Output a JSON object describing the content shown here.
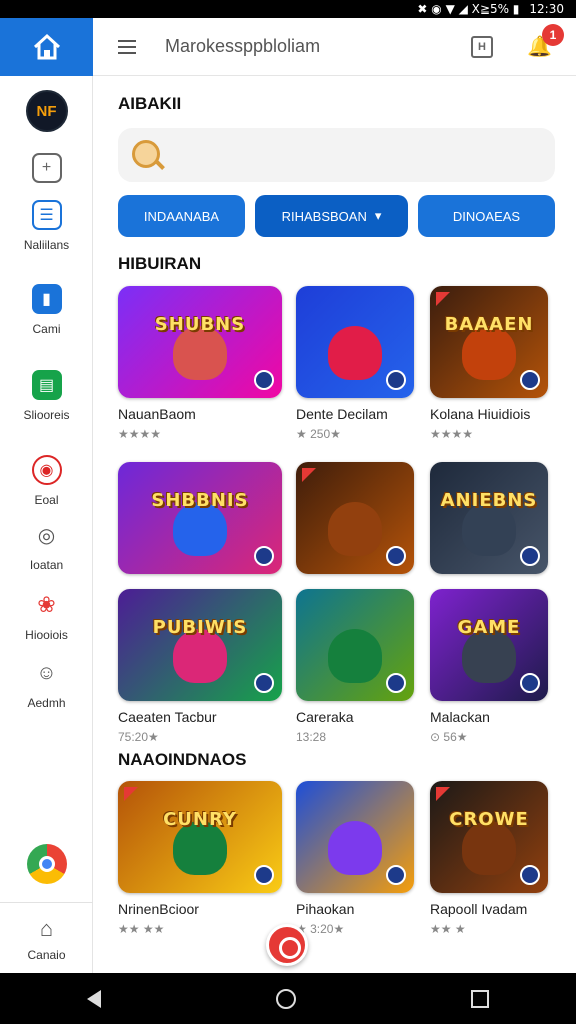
{
  "status_bar": {
    "battery": "✖ ◉ ▼ ◢ X≧5% ▮",
    "time": "12:30"
  },
  "topbar": {
    "title": "Marokessppbloliam",
    "notification_count": "1"
  },
  "sidebar": {
    "logo_text": "NF",
    "items": [
      {
        "label": "",
        "icon": "grid-add-icon",
        "color": "#666"
      },
      {
        "label": "Naliilans",
        "icon": "browser-window-icon",
        "color": "#1a73d9"
      },
      {
        "label": "Cami",
        "icon": "door-icon",
        "color": "#1a73d9"
      },
      {
        "label": "Sliooreis",
        "icon": "cup-icon",
        "color": "#16a34a"
      },
      {
        "label": "Eoal",
        "icon": "target-icon",
        "color": "#dc2626"
      },
      {
        "label": "Ioatan",
        "icon": "ring-icon",
        "color": "#555"
      },
      {
        "label": "Hiooiois",
        "icon": "pinwheel-icon",
        "color": "#e53935"
      },
      {
        "label": "Aedmh",
        "icon": "smiley-icon",
        "color": "#555"
      }
    ],
    "bottom_label": "Canaio"
  },
  "main": {
    "heading": "AIBAKII",
    "chips": [
      {
        "label": "INDAANABA",
        "color": "#1a73d9"
      },
      {
        "label": "RIHABSBOAN",
        "color": "#0b5fc4"
      },
      {
        "label": "DINOAEAS",
        "color": "#1a73d9"
      }
    ],
    "section1_title": "HIBUIRAN",
    "section2_title": "NAAOINDNAOS",
    "games": [
      {
        "name": "NauanBaom",
        "meta": "★★★★",
        "thumb_text": "SHUBNS",
        "bg": "linear-gradient(135deg,#7b2ff7,#f107a3)",
        "char": "#d9534f",
        "hot": false
      },
      {
        "name": "Dente Decilam",
        "meta": "★ 250★",
        "thumb_text": "",
        "bg": "linear-gradient(135deg,#1e3ed8,#2563eb)",
        "char": "#e11d48",
        "hot": false
      },
      {
        "name": "Kolana Hiuidiois",
        "meta": "★★★★",
        "thumb_text": "BAAAEN",
        "bg": "linear-gradient(135deg,#3b1d0e,#b45309)",
        "char": "#c2410c",
        "hot": true
      },
      {
        "name": "",
        "meta": "",
        "thumb_text": "SHBBNIS",
        "bg": "linear-gradient(135deg,#6d28d9,#db2777)",
        "char": "#2563eb",
        "hot": false
      },
      {
        "name": "",
        "meta": "",
        "thumb_text": "",
        "bg": "linear-gradient(135deg,#3f1d0b,#b45309)",
        "char": "#92400e",
        "hot": true
      },
      {
        "name": "",
        "meta": "",
        "thumb_text": "ANIEBNS",
        "bg": "linear-gradient(135deg,#1e293b,#475569)",
        "char": "#334155",
        "hot": false
      },
      {
        "name": "Caeaten Tacbur",
        "meta": "75:20★",
        "thumb_text": "PUBIWIS",
        "bg": "linear-gradient(135deg,#4c1d95,#16a34a)",
        "char": "#db2777",
        "hot": false
      },
      {
        "name": "Careraka",
        "meta": "13:28",
        "thumb_text": "",
        "bg": "linear-gradient(135deg,#0e7490,#65a30d)",
        "char": "#15803d",
        "hot": false
      },
      {
        "name": "Malackan",
        "meta": "⊙ 56★",
        "thumb_text": "GAME",
        "bg": "linear-gradient(135deg,#7e22ce,#1e1b4b)",
        "char": "#374151",
        "hot": false
      },
      {
        "name": "NrinenBcioor",
        "meta": "★★ ★★",
        "thumb_text": "CUNRY",
        "bg": "linear-gradient(135deg,#b45309,#facc15)",
        "char": "#15803d",
        "hot": true
      },
      {
        "name": "Pihaokan",
        "meta": "★ 3:20★",
        "thumb_text": "",
        "bg": "linear-gradient(135deg,#1d4ed8,#f59e0b)",
        "char": "#7c3aed",
        "hot": false
      },
      {
        "name": "Rapooll Ivadam",
        "meta": "★★ ★",
        "thumb_text": "CROWE",
        "bg": "linear-gradient(135deg,#1c1917,#92400e)",
        "char": "#78350f",
        "hot": true
      }
    ]
  }
}
